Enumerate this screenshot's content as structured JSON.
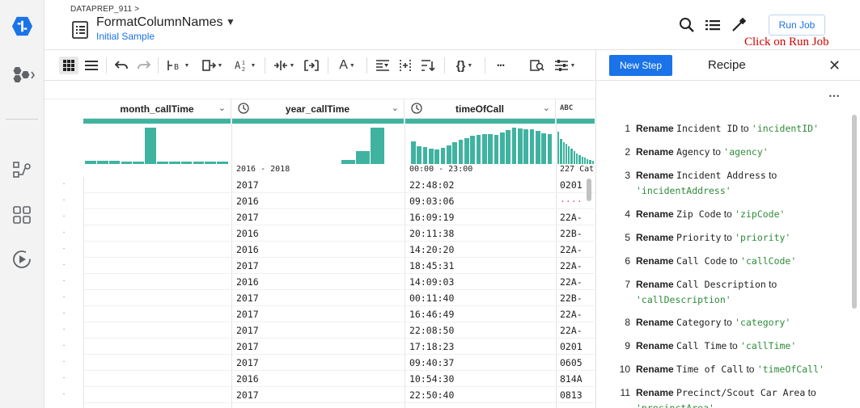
{
  "header": {
    "breadcrumb": "DATAPREP_911 >",
    "title": "FormatColumnNames",
    "subtitle": "Initial Sample",
    "run_job_label": "Run Job",
    "annotation": "Click on Run Job"
  },
  "toolbar": {
    "text_tool_label": "A",
    "more_label": "•••",
    "braces_label": "{}"
  },
  "grid": {
    "columns": [
      {
        "name": "month_callTime",
        "type_icon": "calendar-chevron-icon",
        "range": ""
      },
      {
        "name": "year_callTime",
        "type_icon": "clock-icon",
        "range": "2016 - 2018"
      },
      {
        "name": "timeOfCall",
        "type_icon": "clock-icon",
        "range": "00:00 - 23:00"
      },
      {
        "name": "",
        "type_icon": "abc-icon",
        "type_label": "ABC",
        "range": "227 Cat"
      }
    ],
    "rows": [
      {
        "year": "2017",
        "time": "22:48:02",
        "code": "0201"
      },
      {
        "year": "2016",
        "time": "09:03:06",
        "code": "····"
      },
      {
        "year": "2017",
        "time": "16:09:19",
        "code": "22A-"
      },
      {
        "year": "2016",
        "time": "20:11:38",
        "code": "22B-"
      },
      {
        "year": "2016",
        "time": "14:20:20",
        "code": "22A-"
      },
      {
        "year": "2017",
        "time": "18:45:31",
        "code": "22A-"
      },
      {
        "year": "2016",
        "time": "14:09:03",
        "code": "22A-"
      },
      {
        "year": "2017",
        "time": "00:11:40",
        "code": "22B-"
      },
      {
        "year": "2017",
        "time": "16:46:49",
        "code": "22A-"
      },
      {
        "year": "2017",
        "time": "22:08:50",
        "code": "22A-"
      },
      {
        "year": "2017",
        "time": "17:18:23",
        "code": "0201"
      },
      {
        "year": "2017",
        "time": "09:40:37",
        "code": "0605"
      },
      {
        "year": "2016",
        "time": "10:54:30",
        "code": "814A"
      },
      {
        "year": "2017",
        "time": "22:50:40",
        "code": "0813"
      }
    ],
    "histograms": {
      "month": [
        0.08,
        0.08,
        0.08,
        0.07,
        0.07,
        1.0,
        0.07,
        0.07,
        0.07,
        0.07,
        0.07,
        0.07
      ],
      "year": [
        0.12,
        0.35,
        1.0
      ],
      "time": [
        0.62,
        0.5,
        0.46,
        0.42,
        0.4,
        0.45,
        0.52,
        0.6,
        0.66,
        0.72,
        0.78,
        0.8,
        0.82,
        0.82,
        0.8,
        0.86,
        0.94,
        1.0,
        0.98,
        0.95,
        0.96,
        0.92,
        0.85,
        0.82
      ],
      "cat": [
        0.9,
        0.7,
        0.6,
        0.55,
        0.5,
        0.42,
        0.36,
        0.3,
        0.25,
        0.2,
        0.17,
        0.14,
        0.12,
        0.1
      ]
    }
  },
  "recipe": {
    "new_step_label": "New Step",
    "title": "Recipe",
    "steps": [
      {
        "num": "1",
        "kw": "Rename",
        "src": "Incident ID",
        "to": "to",
        "val": "'incidentID'"
      },
      {
        "num": "2",
        "kw": "Rename",
        "src": "Agency",
        "to": "to",
        "val": "'agency'"
      },
      {
        "num": "3",
        "kw": "Rename",
        "src": "Incident Address",
        "to": "to",
        "val": "'incidentAddress'"
      },
      {
        "num": "4",
        "kw": "Rename",
        "src": "Zip Code",
        "to": "to",
        "val": "'zipCode'"
      },
      {
        "num": "5",
        "kw": "Rename",
        "src": "Priority",
        "to": "to",
        "val": "'priority'"
      },
      {
        "num": "6",
        "kw": "Rename",
        "src": "Call Code",
        "to": "to",
        "val": "'callCode'"
      },
      {
        "num": "7",
        "kw": "Rename",
        "src": "Call Description",
        "to": "to",
        "val": "'callDescription'"
      },
      {
        "num": "8",
        "kw": "Rename",
        "src": "Category",
        "to": "to",
        "val": "'category'"
      },
      {
        "num": "9",
        "kw": "Rename",
        "src": "Call Time",
        "to": "to",
        "val": "'callTime'"
      },
      {
        "num": "10",
        "kw": "Rename",
        "src": "Time of Call",
        "to": "to",
        "val": "'timeOfCall'"
      },
      {
        "num": "11",
        "kw": "Rename",
        "src": "Precinct/Scout Car Area",
        "to": "to",
        "val": "'precinctArea'"
      }
    ]
  },
  "colors": {
    "accent": "#1a73e8",
    "teal": "#3fb3a0",
    "annotation": "#d50000",
    "recipe_value": "#2e8b3a"
  }
}
